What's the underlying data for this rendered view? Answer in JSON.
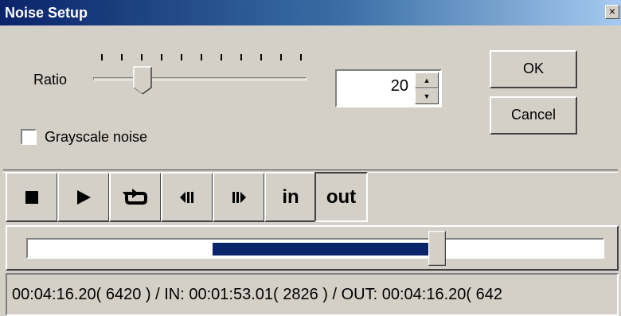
{
  "window": {
    "title": "Noise Setup",
    "close_label": "×"
  },
  "ratio": {
    "label": "Ratio",
    "value": "20",
    "up_glyph": "▲",
    "down_glyph": "▼"
  },
  "grayscale": {
    "label": "Grayscale noise",
    "checked": false
  },
  "buttons": {
    "ok": "OK",
    "cancel": "Cancel"
  },
  "transport": {
    "stop_icon": "stop-icon",
    "play_icon": "play-icon",
    "loop_icon": "loop-icon",
    "prev_frame_icon": "previous-frame-icon",
    "next_frame_icon": "next-frame-icon",
    "in_label": "in",
    "out_label": "out"
  },
  "timeline": {
    "selection_color": "#0a246a"
  },
  "status": {
    "text": "00:04:16.20( 6420 ) / IN: 00:01:53.01( 2826 ) / OUT: 00:04:16.20( 642"
  }
}
